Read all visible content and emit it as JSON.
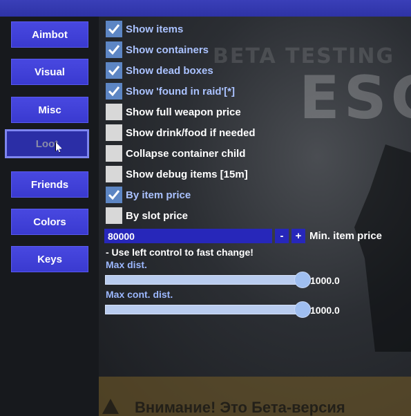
{
  "background": {
    "word_testing": "BETA TESTING",
    "word_escape": "ESCAPE",
    "banner_text": "Внимание! Это Бета-версия"
  },
  "nav": {
    "items": [
      {
        "label": "Aimbot",
        "active": false
      },
      {
        "label": "Visual",
        "active": false
      },
      {
        "label": "Misc",
        "active": false
      },
      {
        "label": "Loot",
        "active": true
      },
      {
        "label": "Friends",
        "active": false
      },
      {
        "label": "Colors",
        "active": false
      },
      {
        "label": "Keys",
        "active": false
      }
    ]
  },
  "loot": {
    "options": [
      {
        "label": "Show items",
        "checked": true
      },
      {
        "label": "Show containers",
        "checked": true
      },
      {
        "label": "Show dead boxes",
        "checked": true
      },
      {
        "label": "Show 'found in raid'[*]",
        "checked": true
      },
      {
        "label": "Show full weapon price",
        "checked": false
      },
      {
        "label": "Show drink/food if needed",
        "checked": false
      },
      {
        "label": "Collapse container child",
        "checked": false
      },
      {
        "label": "Show debug items [15m]",
        "checked": false
      },
      {
        "label": "By item price",
        "checked": true
      },
      {
        "label": "By slot price",
        "checked": false
      }
    ],
    "min_price": {
      "value": "80000",
      "decrement_label": "-",
      "increment_label": "+",
      "label": "Min. item price"
    },
    "hint": "- Use left control to fast change!",
    "max_dist": {
      "label": "Max dist.",
      "value_text": "1000.0",
      "fraction": 1.0
    },
    "max_cont_dist": {
      "label": "Max cont. dist.",
      "value_text": "1000.0",
      "fraction": 1.0
    }
  },
  "colors": {
    "accent": "#3a3ad0",
    "checked_box": "#5d86c4",
    "checked_text": "#aac2ff",
    "slider_label": "#9cb8ff"
  }
}
